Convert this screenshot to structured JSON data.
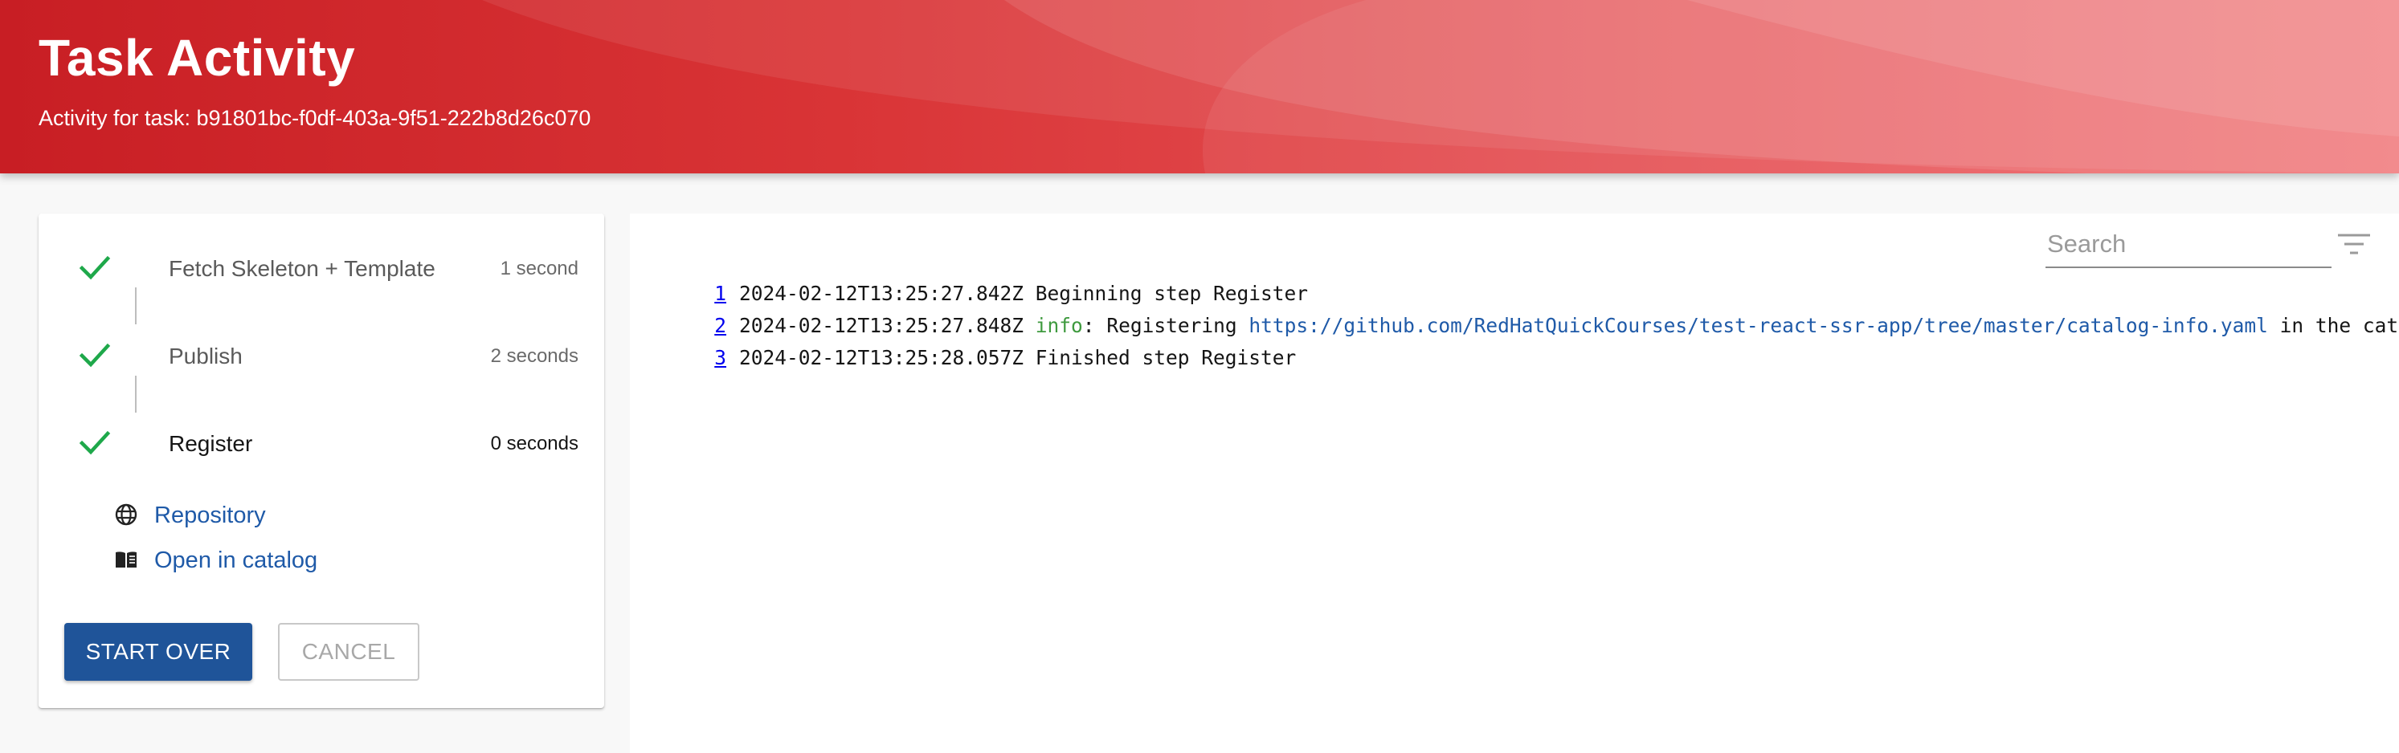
{
  "header": {
    "title": "Task Activity",
    "subtitle": "Activity for task: b91801bc-f0df-403a-9f51-222b8d26c070"
  },
  "steps": [
    {
      "label": "Fetch Skeleton + Template",
      "duration": "1 second",
      "status": "completed"
    },
    {
      "label": "Publish",
      "duration": "2 seconds",
      "status": "completed"
    },
    {
      "label": "Register",
      "duration": "0 seconds",
      "status": "completed"
    }
  ],
  "links": {
    "repository": "Repository",
    "open_in_catalog": "Open in catalog"
  },
  "actions": {
    "start_over": "Start Over",
    "cancel": "Cancel"
  },
  "search": {
    "placeholder": "Search"
  },
  "log": {
    "lines": [
      {
        "num": "1",
        "timestamp": "2024-02-12T13:25:27.842Z",
        "message": "Beginning step Register"
      },
      {
        "num": "2",
        "timestamp": "2024-02-12T13:25:27.848Z",
        "level": "info",
        "sep": ":",
        "pre": "Registering",
        "url": "https://github.com/RedHatQuickCourses/test-react-ssr-app/tree/master/catalog-info.yaml",
        "post": "in the catal"
      },
      {
        "num": "3",
        "timestamp": "2024-02-12T13:25:28.057Z",
        "message": "Finished step Register"
      }
    ]
  },
  "colors": {
    "header_red": "#d93436",
    "success_green": "#1ea84a",
    "primary_blue": "#1f5499",
    "link_blue": "#1f5aa8"
  }
}
